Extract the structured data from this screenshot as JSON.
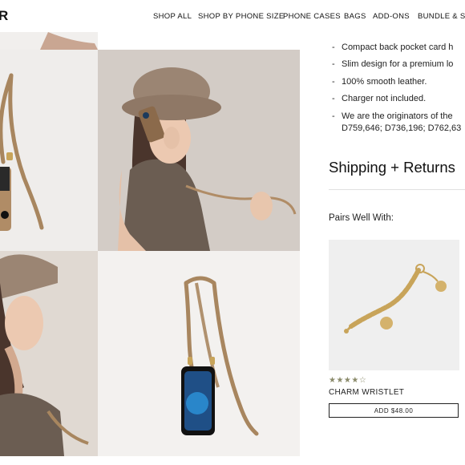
{
  "header": {
    "logo_fragment": "R",
    "nav": [
      "SHOP ALL",
      "SHOP BY PHONE SIZE",
      "PHONE CASES",
      "BAGS",
      "ADD-ONS",
      "BUNDLE & SA"
    ]
  },
  "gallery": {
    "tiles": [
      {
        "name": "crossbody-strap-flatlay",
        "bg": "#efedeb"
      },
      {
        "name": "model-fur-hat-phone",
        "bg": "#cfc8c2"
      },
      {
        "name": "model-closeup",
        "bg": "#d8d1ca"
      },
      {
        "name": "phone-case-crossbody",
        "bg": "#f3f1ef"
      }
    ]
  },
  "product": {
    "features": [
      "Compact back pocket card h",
      "Slim design for a premium lo",
      "100% smooth leather.",
      "Charger not included.",
      "We are the originators of the"
    ],
    "patent_line": "D759,646; D736,196; D762,63",
    "shipping_title": "Shipping + Returns"
  },
  "pairs_well": {
    "heading": "Pairs Well With:",
    "item": {
      "name": "CHARM WRISTLET",
      "rating_stars": "★★★★☆",
      "rating": 4.5,
      "button_label": "ADD $48.00"
    }
  },
  "colors": {
    "strap": "#a8865f",
    "hat": "#9b8573",
    "gold": "#c8a45a"
  }
}
